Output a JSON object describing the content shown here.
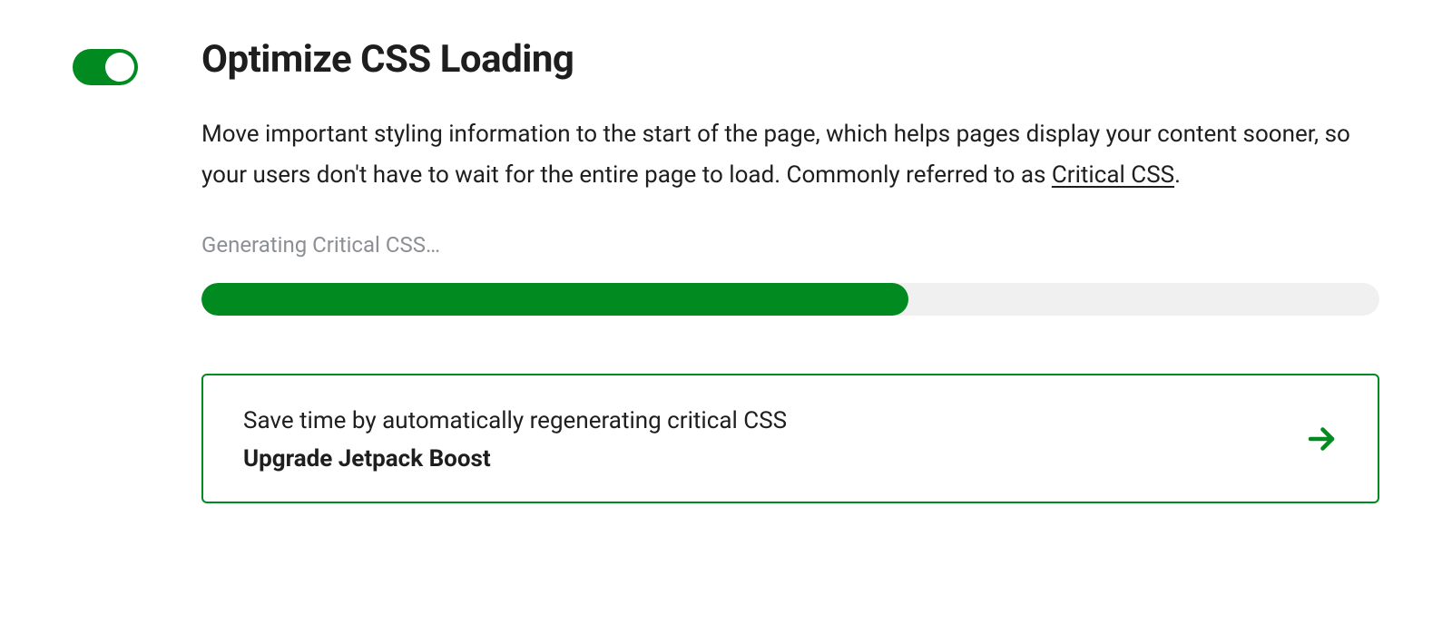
{
  "feature": {
    "enabled": true,
    "title": "Optimize CSS Loading",
    "description_before_link": "Move important styling information to the start of the page, which helps pages display your content sooner, so your users don't have to wait for the entire page to load. Commonly referred to as ",
    "description_link_text": "Critical CSS",
    "description_after_link": "."
  },
  "progress": {
    "status_text": "Generating Critical CSS…",
    "percent": 60
  },
  "cta": {
    "line1": "Save time by automatically regenerating critical CSS",
    "line2": "Upgrade Jetpack Boost"
  },
  "colors": {
    "accent": "#008a20",
    "track": "#f0f0f1",
    "text_muted": "#8c8f94"
  }
}
